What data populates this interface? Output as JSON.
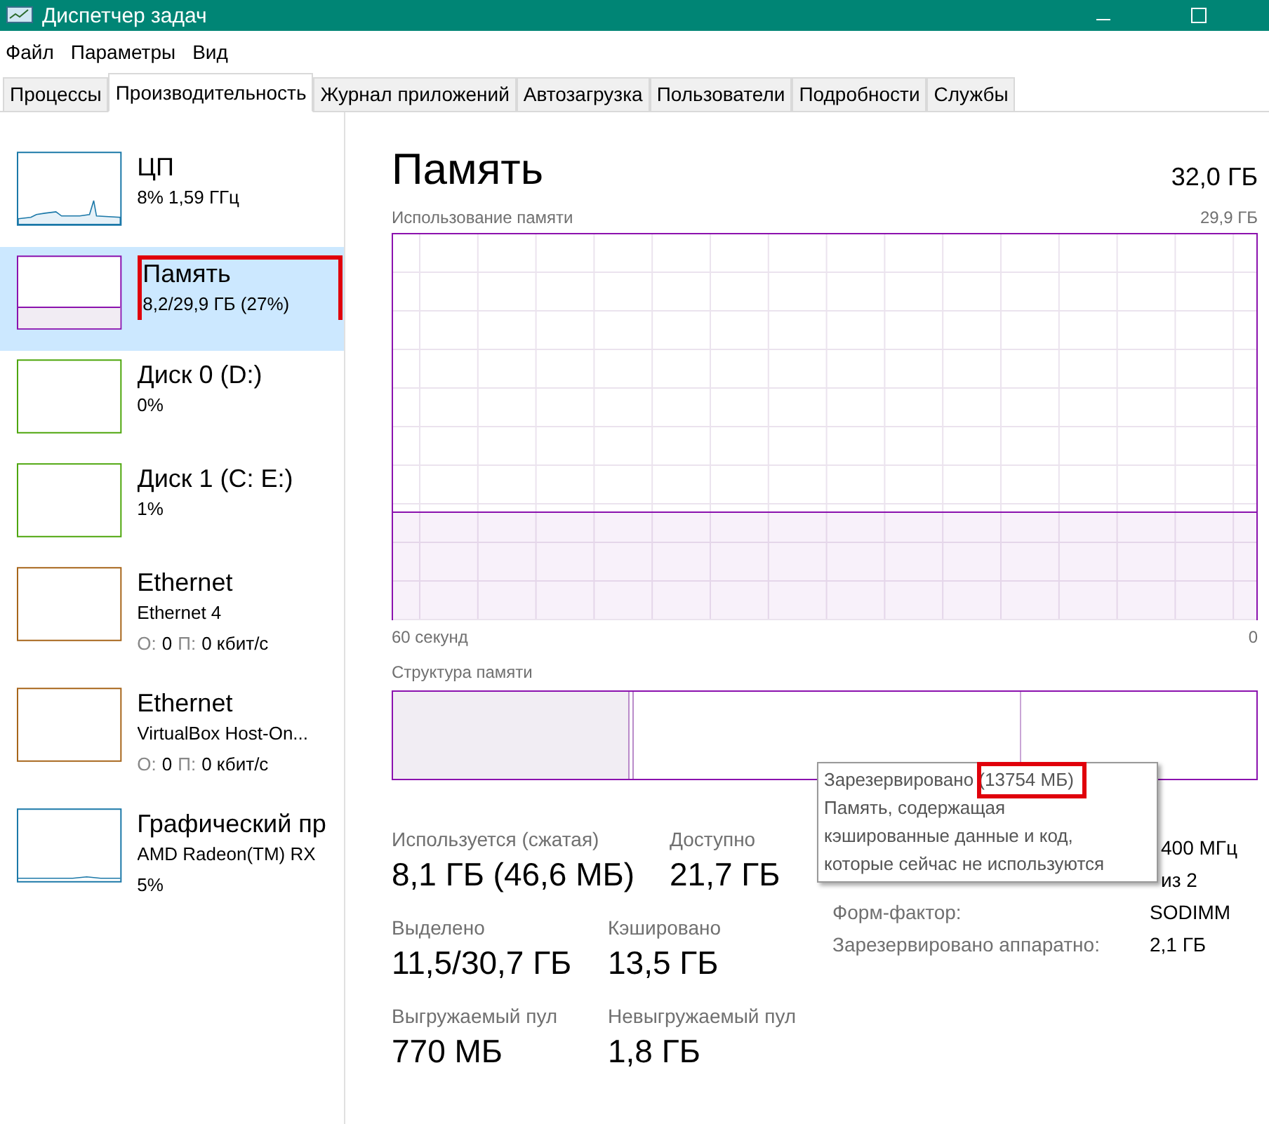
{
  "window": {
    "title": "Диспетчер задач"
  },
  "menu": [
    "Файл",
    "Параметры",
    "Вид"
  ],
  "tabs": [
    {
      "label": "Процессы",
      "selected": false
    },
    {
      "label": "Производительность",
      "selected": true
    },
    {
      "label": "Журнал приложений",
      "selected": false
    },
    {
      "label": "Автозагрузка",
      "selected": false
    },
    {
      "label": "Пользователи",
      "selected": false
    },
    {
      "label": "Подробности",
      "selected": false
    },
    {
      "label": "Службы",
      "selected": false
    }
  ],
  "sidebar": {
    "items": [
      {
        "kind": "cpu",
        "title": "ЦП",
        "lines": [
          "8%  1,59 ГГц"
        ],
        "selected": false,
        "highlighted": false
      },
      {
        "kind": "memory",
        "title": "Память",
        "lines": [
          "8,2/29,9 ГБ (27%)"
        ],
        "selected": true,
        "highlighted": true
      },
      {
        "kind": "disk",
        "title": "Диск 0 (D:)",
        "lines": [
          "0%"
        ],
        "selected": false,
        "highlighted": false
      },
      {
        "kind": "disk",
        "title": "Диск 1 (C: E:)",
        "lines": [
          "1%"
        ],
        "selected": false,
        "highlighted": false
      },
      {
        "kind": "network",
        "title": "Ethernet",
        "lines": [
          "Ethernet 4"
        ],
        "send_label": "О:",
        "send": "0",
        "recv_label": "П:",
        "recv": "0 кбит/с",
        "selected": false,
        "highlighted": false
      },
      {
        "kind": "network",
        "title": "Ethernet",
        "lines": [
          "VirtualBox Host-On..."
        ],
        "send_label": "О:",
        "send": "0",
        "recv_label": "П:",
        "recv": "0 кбит/с",
        "selected": false,
        "highlighted": false
      },
      {
        "kind": "gpu",
        "title": "Графический пр",
        "lines": [
          "AMD Radeon(TM) RX",
          "5%"
        ],
        "selected": false,
        "highlighted": false
      }
    ]
  },
  "main": {
    "title": "Память",
    "total": "32,0 ГБ",
    "usage_graph": {
      "label": "Использование памяти",
      "max": "29,9 ГБ",
      "x_start": "60 секунд",
      "x_end": "0"
    },
    "composition": {
      "label": "Структура памяти"
    },
    "stats": [
      {
        "label": "Используется (сжатая)",
        "value": "8,1 ГБ (46,6 МБ)"
      },
      {
        "label": "Доступно",
        "value": "21,7 ГБ"
      },
      {
        "label": "Выделено",
        "value": "11,5/30,7 ГБ"
      },
      {
        "label": "Кэшировано",
        "value": "13,5 ГБ"
      },
      {
        "label": "Выгружаемый пул",
        "value": "770 МБ"
      },
      {
        "label": "Невыгружаемый пул",
        "value": "1,8 ГБ"
      }
    ],
    "details": [
      {
        "value": "400 МГц"
      },
      {
        "value": "из 2"
      },
      {
        "label": "Форм-фактор:",
        "value": "SODIMM"
      },
      {
        "label": "Зарезервировано аппаратно:",
        "value": "2,1 ГБ"
      }
    ],
    "tooltip": {
      "title_prefix": "Зарезервировано (",
      "title_value": "13754 МБ)",
      "text_lines": [
        "Память, содержащая",
        "кэшированные данные и код,",
        "которые сейчас не используются"
      ],
      "highlighted": true
    }
  }
}
